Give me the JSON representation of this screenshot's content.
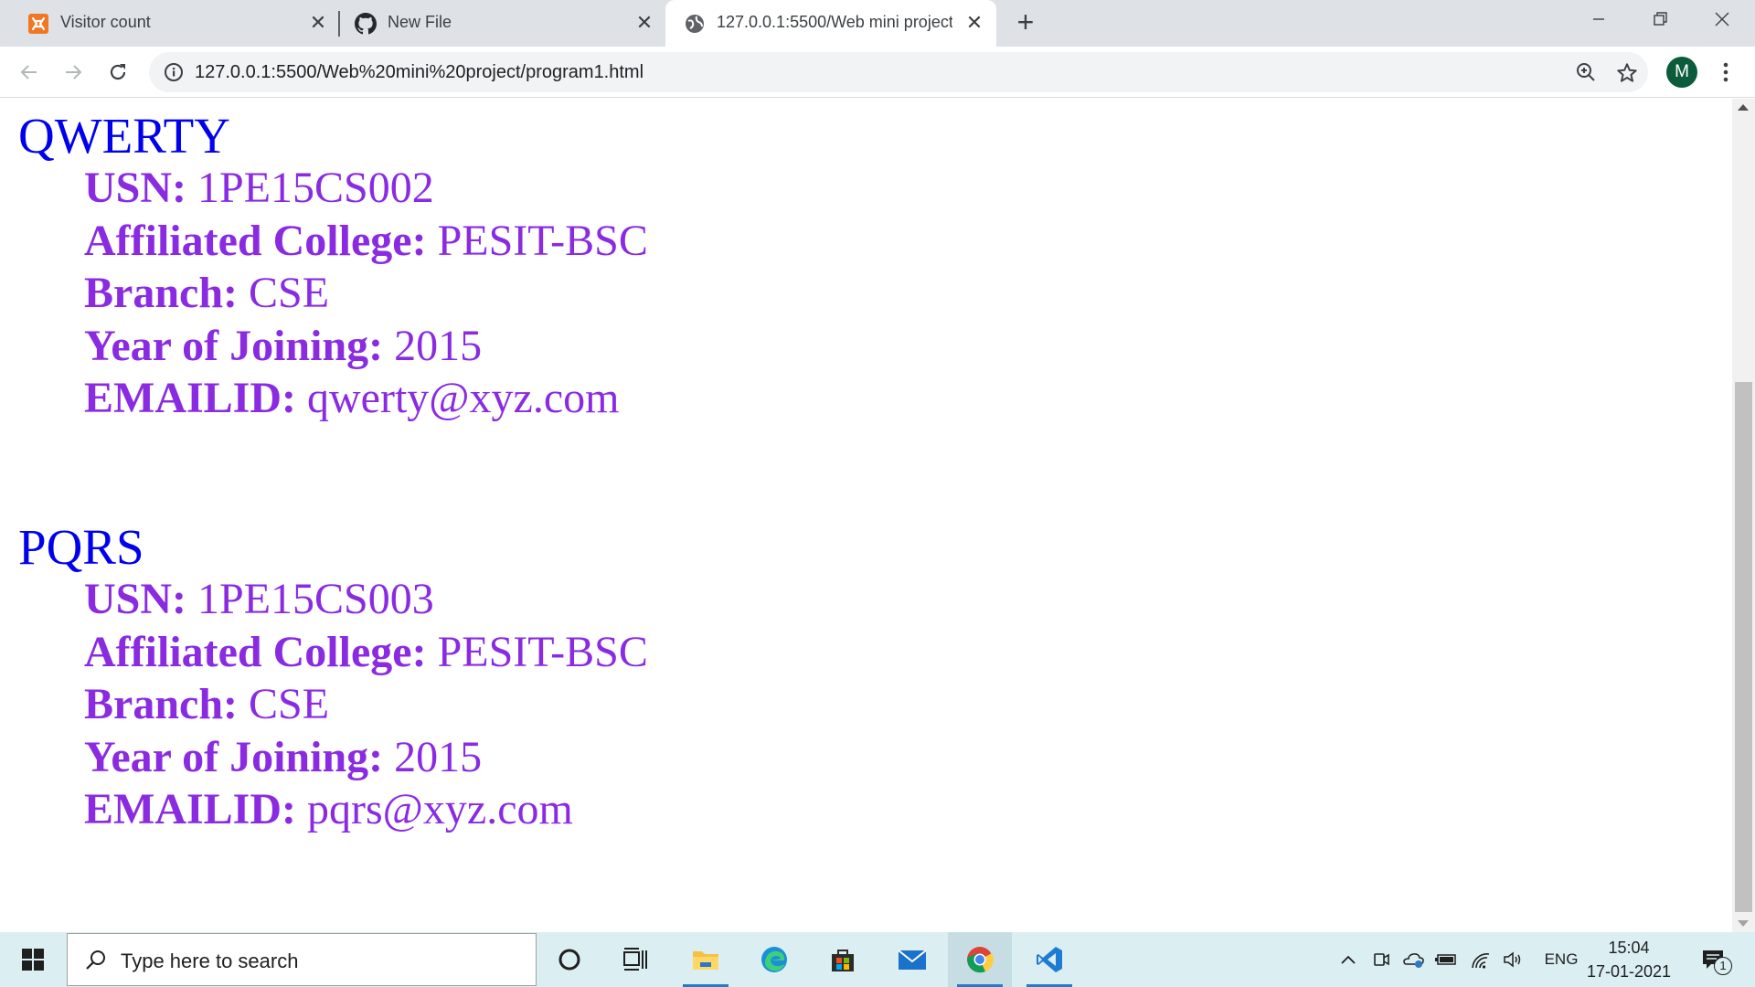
{
  "browser": {
    "tabs": [
      {
        "title": "Visitor count",
        "icon": "xampp-icon",
        "active": false
      },
      {
        "title": "New File",
        "icon": "github-icon",
        "active": false
      },
      {
        "title": "127.0.0.1:5500/Web mini project/",
        "icon": "globe-icon",
        "active": true
      }
    ],
    "new_tab_label": "+",
    "url": "127.0.0.1:5500/Web%20mini%20project/program1.html",
    "profile_initial": "M"
  },
  "students": [
    {
      "name": "QWERTY",
      "fields": [
        {
          "label": "USN:",
          "value": "1PE15CS002"
        },
        {
          "label": "Affiliated College:",
          "value": "PESIT-BSC"
        },
        {
          "label": "Branch:",
          "value": "CSE"
        },
        {
          "label": "Year of Joining:",
          "value": "2015"
        },
        {
          "label": "EMAILID:",
          "value": "qwerty@xyz.com"
        }
      ]
    },
    {
      "name": "PQRS",
      "fields": [
        {
          "label": "USN:",
          "value": "1PE15CS003"
        },
        {
          "label": "Affiliated College:",
          "value": "PESIT-BSC"
        },
        {
          "label": "Branch:",
          "value": "CSE"
        },
        {
          "label": "Year of Joining:",
          "value": "2015"
        },
        {
          "label": "EMAILID:",
          "value": "pqrs@xyz.com"
        }
      ]
    }
  ],
  "colors": {
    "student_name": "#0000ee",
    "student_field": "#8a2be2",
    "taskbar": "#dbeef2"
  },
  "taskbar": {
    "search_placeholder": "Type here to search",
    "apps": [
      "cortana-icon",
      "task-view-icon",
      "file-explorer-icon",
      "edge-icon",
      "store-icon",
      "mail-icon",
      "chrome-icon",
      "vscode-icon"
    ],
    "language": "ENG",
    "time": "15:04",
    "date": "17-01-2021",
    "notification_count": "1"
  }
}
